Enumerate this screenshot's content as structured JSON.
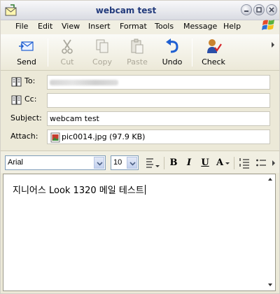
{
  "window": {
    "title": "webcam test"
  },
  "menu": {
    "file": "File",
    "edit": "Edit",
    "view": "View",
    "insert": "Insert",
    "format": "Format",
    "tools": "Tools",
    "message": "Message",
    "help": "Help"
  },
  "toolbar": {
    "send": "Send",
    "cut": "Cut",
    "copy": "Copy",
    "paste": "Paste",
    "undo": "Undo",
    "check": "Check"
  },
  "fields": {
    "to_label": "To:",
    "to_value": "",
    "cc_label": "Cc:",
    "cc_value": "",
    "subject_label": "Subject:",
    "subject_value": "webcam test",
    "attach_label": "Attach:",
    "attach_value": "pic0014.jpg (97.9 KB)"
  },
  "format": {
    "font": "Arial",
    "size": "10",
    "bold": "B",
    "italic": "I",
    "underline": "U",
    "font_color": "A"
  },
  "body": {
    "text": "지니어스 Look 1320 메일 테스트"
  },
  "icons": [
    "app-envelope-icon",
    "minimize-icon",
    "maximize-icon",
    "close-icon",
    "windows-logo-icon",
    "send-icon",
    "cut-icon",
    "copy-icon",
    "paste-icon",
    "undo-icon",
    "check-icon",
    "address-book-icon",
    "image-file-icon",
    "paragraph-style-icon",
    "font-color-icon",
    "numbered-list-icon",
    "bullet-list-icon"
  ],
  "colors": {
    "title_text": "#233b7c",
    "undo_blue": "#1f5fd1",
    "disabled_text": "#aca899"
  }
}
